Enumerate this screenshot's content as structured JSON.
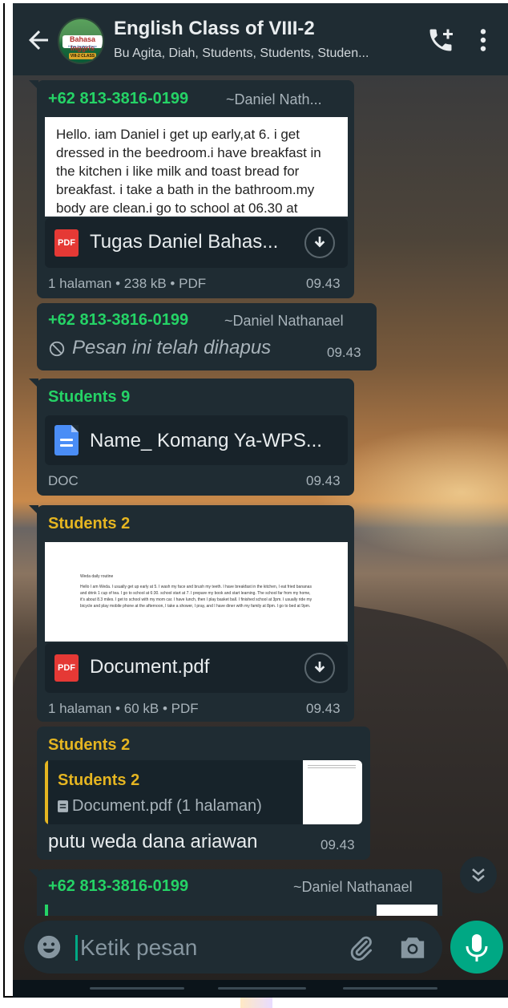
{
  "header": {
    "title": "English Class of VIII-2",
    "subtitle": "Bu Agita, Diah, Students, Students, Studen...",
    "avatar_text": "Bahasa Inggris",
    "avatar_sub": "Kelas English Kingo",
    "avatar_badge": "VIII-2 CLASS"
  },
  "messages": [
    {
      "sender": "+62 813-3816-0199",
      "alias": "~Daniel Nath...",
      "preview_text": "Hello. iam Daniel i get up early,at 6. i get dressed in the beedroom.i have breakfast in the kitchen i like milk and toast bread for breakfast. i take a bath in the bathroom.my body are clean.i go to school at 06.30 at",
      "file_badge": "PDF",
      "file_name": "Tugas Daniel Bahas...",
      "meta": "1 halaman • 238 kB • PDF",
      "time": "09.43"
    },
    {
      "sender": "+62 813-3816-0199",
      "alias": "~Daniel Nathanael",
      "deleted_text": "Pesan ini telah dihapus",
      "time": "09.43"
    },
    {
      "sender": "Students 9",
      "file_name": "Name_ Komang Ya-WPS...",
      "meta": "DOC",
      "time": "09.43"
    },
    {
      "sender": "Students 2",
      "preview_title": "Weda daily routine",
      "preview_text": "Hello I am Weda. I usually get up early at 5. I wash my face and brush my teeth. I have breakfast in the kitchen, I eat fried bananas and drink 1 cup of tea. I go to school at 6:30. school start at 7. I prepare my book and start learning. The school far from my home, it's about 8.3 miles. I get to school with my mom car. I have lunch, then I play basket ball. I finished school at 3pm. I usually ride my bicycle and play mobile phone at the afternoon, I take a shower, I pray, and I have diner with my family at 8pm. I go to bed at 9pm.",
      "file_badge": "PDF",
      "file_name": "Document.pdf",
      "meta": "1 halaman • 60 kB • PDF",
      "time": "09.43"
    },
    {
      "sender": "Students 2",
      "quote_sender": "Students 2",
      "quote_text": "Document.pdf (1 halaman)",
      "text": "putu weda dana ariawan",
      "time": "09.43"
    },
    {
      "sender": "+62 813-3816-0199",
      "alias": "~Daniel Nathanael"
    }
  ],
  "input": {
    "placeholder": "Ketik pesan"
  },
  "icons": {
    "back": "arrow-left-icon",
    "add_call": "phone-plus-icon",
    "more": "more-vertical-icon",
    "download": "download-icon",
    "deleted": "blocked-icon",
    "scroll_down": "chevron-double-down-icon",
    "emoji": "emoji-icon",
    "attach": "paperclip-icon",
    "camera": "camera-icon",
    "mic": "microphone-icon"
  },
  "colors": {
    "header_bg": "#1f2c33",
    "bubble_bg": "#1f2c33",
    "sender_green": "#25d366",
    "sender_yellow": "#e5b521",
    "accent": "#00a884"
  }
}
